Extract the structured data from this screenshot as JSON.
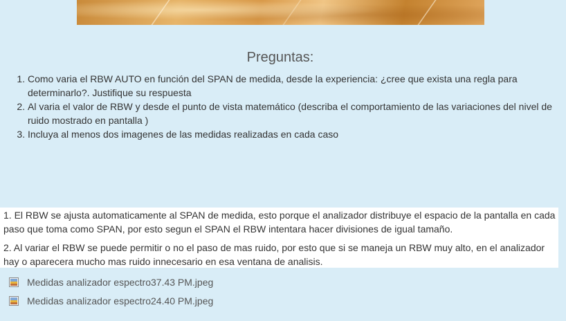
{
  "questions": {
    "title": "Preguntas:",
    "items": [
      {
        "text": "Como varia el RBW AUTO en función del SPAN de medida, desde la experiencia: ¿cree que exista una regla para determinarlo?. Justifique su respuesta"
      },
      {
        "text": "Al varia el valor de RBW y desde el punto de vista matemático (describa el comportamiento de las variaciones del nivel de ruido mostrado en pantalla )"
      },
      {
        "text": "Incluya al menos dos imagenes de las medidas realizadas en cada caso"
      }
    ]
  },
  "answer": {
    "paragraphs": [
      {
        "text": "1. El RBW se ajusta automaticamente al SPAN de medida, esto porque el analizador distribuye el espacio de la pantalla en cada paso que toma como SPAN, por esto segun el SPAN el RBW intentara hacer divisiones de igual tamaño."
      },
      {
        "text": "2. Al variar el RBW se puede permitir o no el paso de mas ruido, por esto que si se maneja un RBW muy alto, en el analizador hay o aparecera mucho mas ruido innecesario en esa ventana de analisis."
      }
    ]
  },
  "attachments": [
    {
      "name": "Medidas analizador espectro37.43 PM.jpeg",
      "icon": "image-file-icon"
    },
    {
      "name": "Medidas analizador espectro24.40 PM.jpeg",
      "icon": "image-file-icon"
    }
  ],
  "colors": {
    "page_background": "#d9edf7",
    "answer_background": "#ffffff",
    "text": "#333333",
    "link": "#555555"
  }
}
